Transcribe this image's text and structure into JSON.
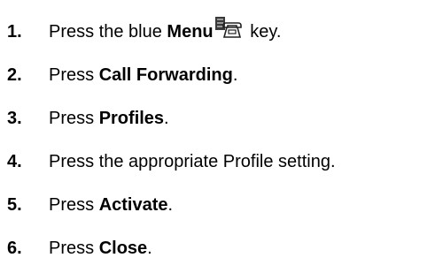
{
  "steps": [
    {
      "number": "1.",
      "pre": "Press the blue ",
      "bold": "Menu",
      "post": " key.",
      "icon": "phone-menu-icon"
    },
    {
      "number": "2.",
      "pre": "Press ",
      "bold": "Call Forwarding",
      "post": "."
    },
    {
      "number": "3.",
      "pre": "Press ",
      "bold": "Profiles",
      "post": "."
    },
    {
      "number": "4.",
      "pre": "Press the appropriate Profile setting.",
      "bold": "",
      "post": ""
    },
    {
      "number": "5.",
      "pre": "Press ",
      "bold": "Activate",
      "post": "."
    },
    {
      "number": "6.",
      "pre": "Press ",
      "bold": "Close",
      "post": "."
    }
  ]
}
